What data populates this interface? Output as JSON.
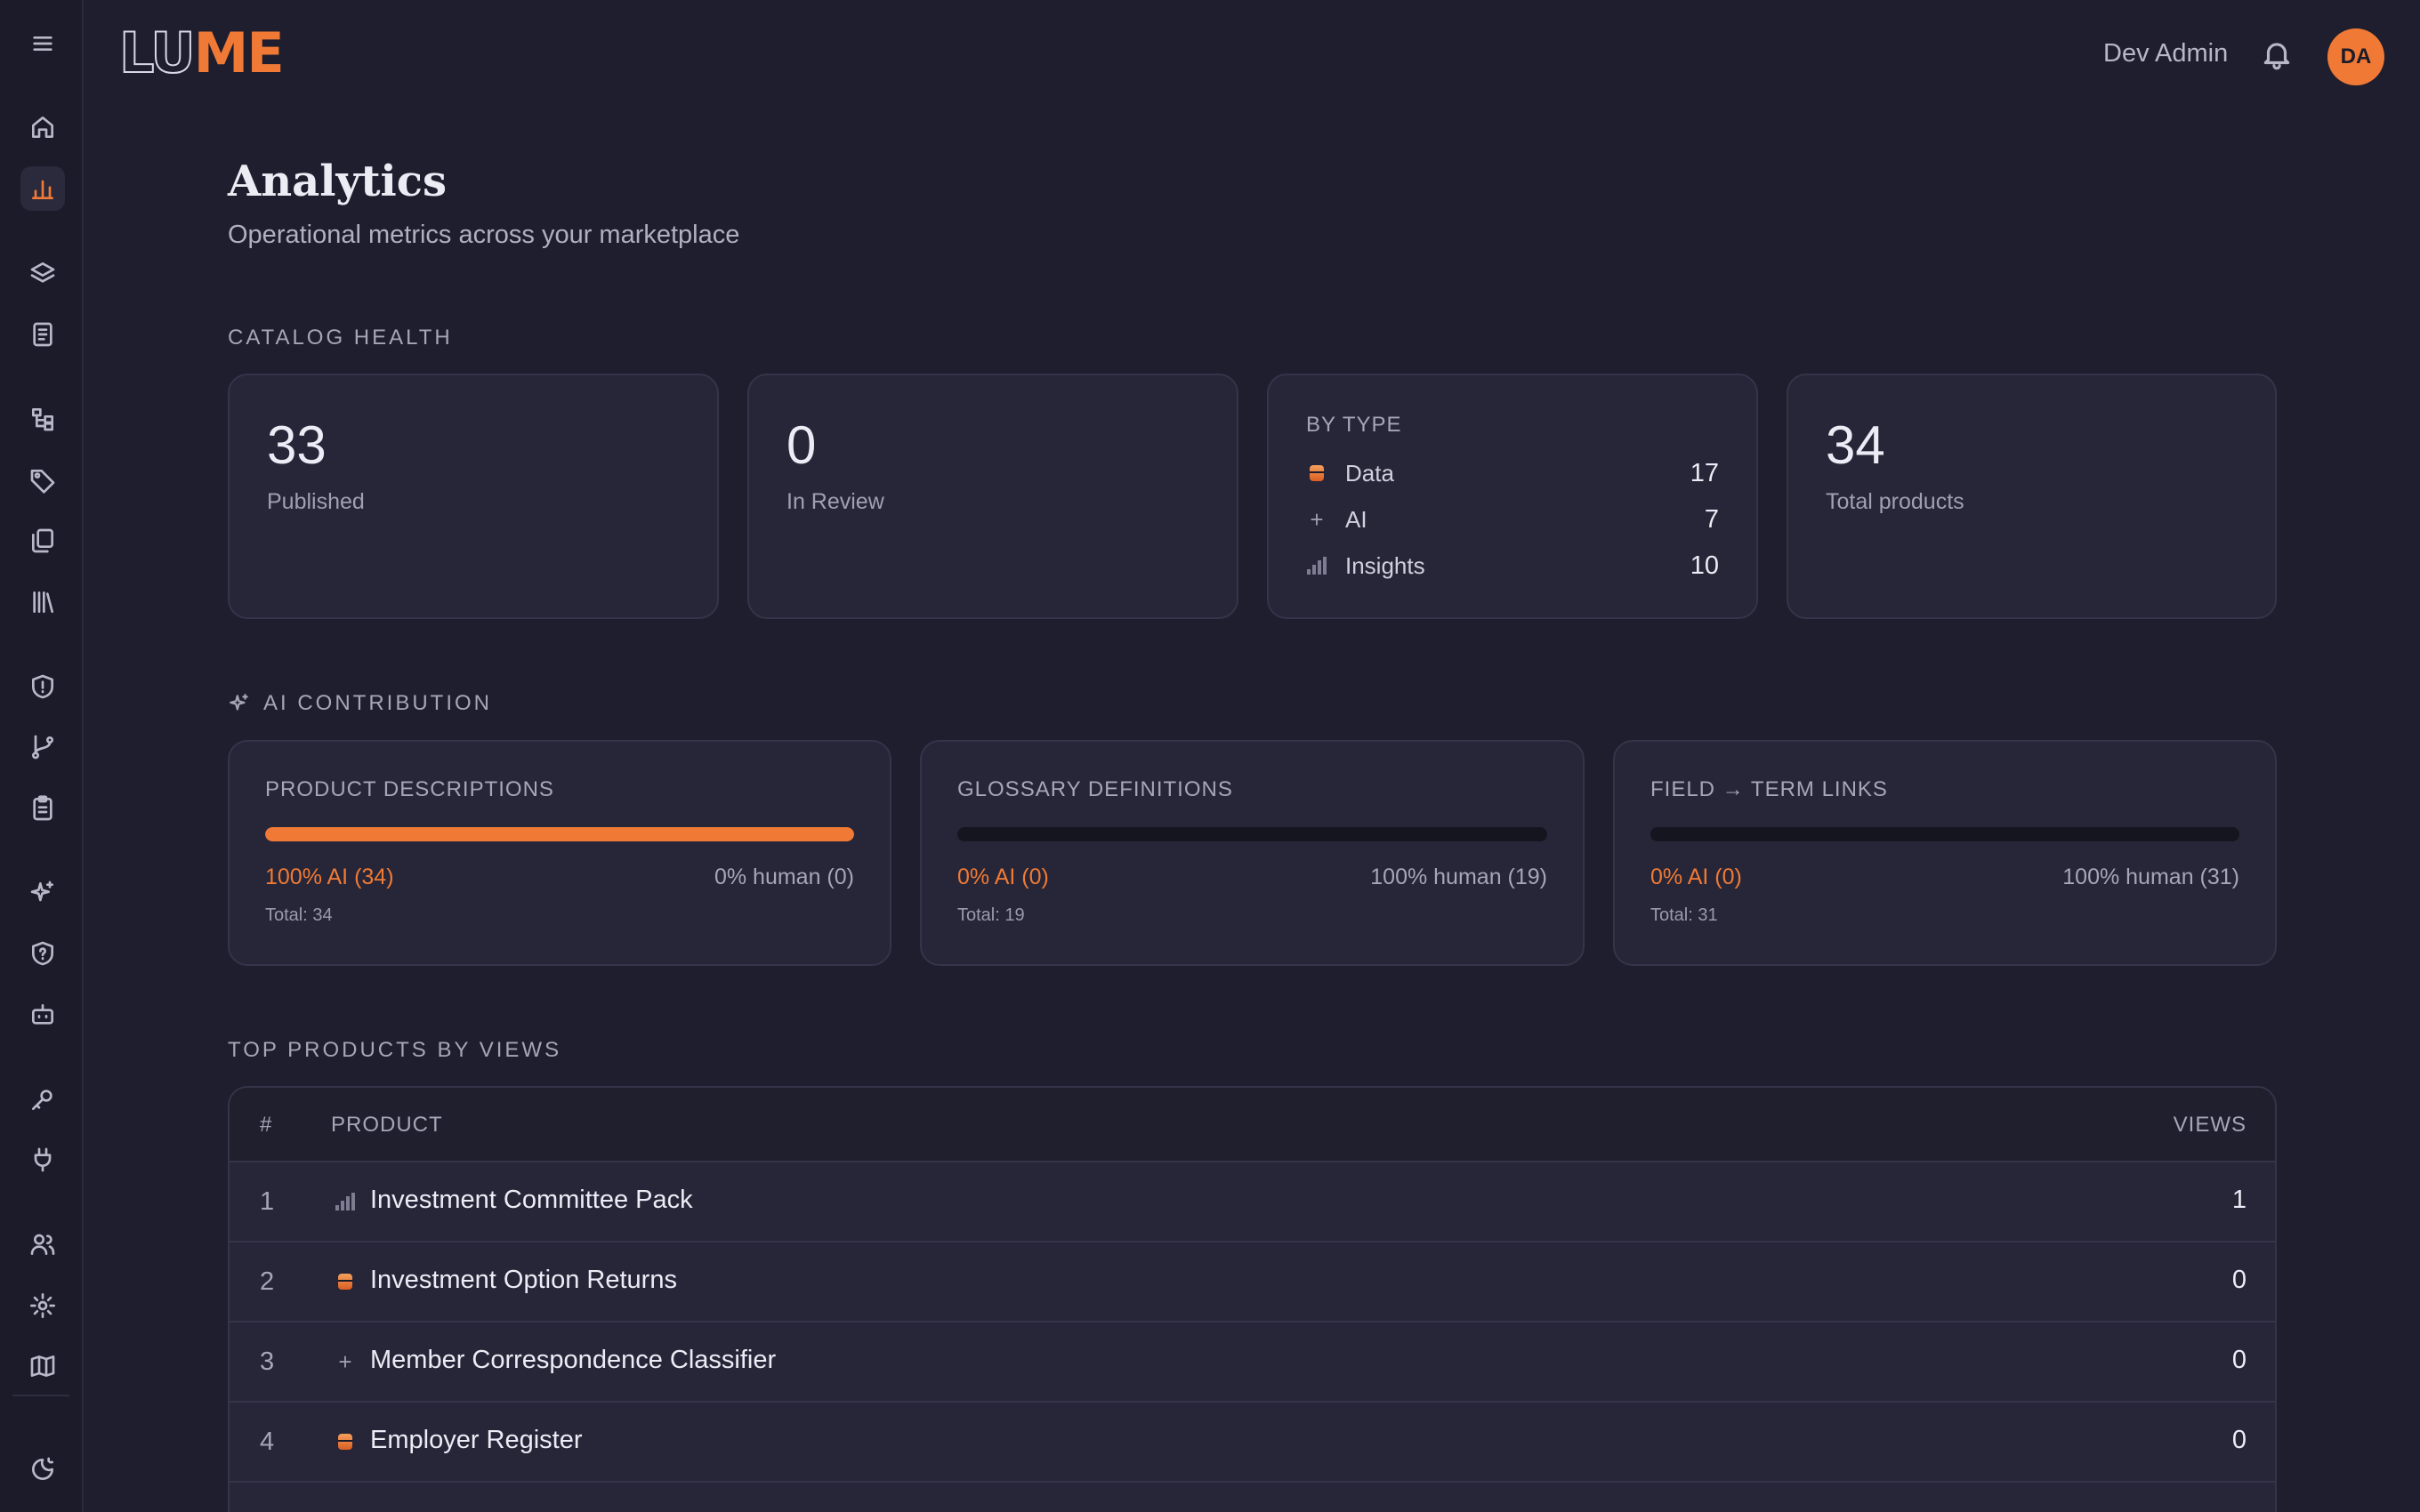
{
  "brand": {
    "logo_part1": "LU",
    "logo_part2": "ME"
  },
  "header": {
    "user_name": "Dev Admin",
    "avatar_initials": "DA"
  },
  "sidebar": {
    "items": [
      {
        "icon": "menu-icon"
      },
      {
        "icon": "home-icon"
      },
      {
        "icon": "analytics-icon",
        "active": true
      },
      {
        "icon": "layers-icon"
      },
      {
        "icon": "document-icon"
      },
      {
        "icon": "hierarchy-icon"
      },
      {
        "icon": "tag-icon"
      },
      {
        "icon": "copy-icon"
      },
      {
        "icon": "library-icon"
      },
      {
        "icon": "shield-alert-icon"
      },
      {
        "icon": "git-branch-icon"
      },
      {
        "icon": "clipboard-icon"
      },
      {
        "icon": "sparkles-icon"
      },
      {
        "icon": "shield-question-icon"
      },
      {
        "icon": "bot-icon"
      },
      {
        "icon": "key-icon"
      },
      {
        "icon": "plug-icon"
      },
      {
        "icon": "users-icon"
      },
      {
        "icon": "settings-icon"
      },
      {
        "icon": "map-icon"
      },
      {
        "icon": "theme-toggle-icon"
      }
    ]
  },
  "page": {
    "title": "Analytics",
    "subtitle": "Operational metrics across your marketplace"
  },
  "catalog_health": {
    "label": "CATALOG HEALTH",
    "published": {
      "value": "33",
      "label": "Published"
    },
    "in_review": {
      "value": "0",
      "label": "In Review"
    },
    "by_type": {
      "title": "BY TYPE",
      "rows": [
        {
          "icon": "data-icon",
          "label": "Data",
          "value": "17"
        },
        {
          "icon": "ai-icon",
          "label": "AI",
          "value": "7"
        },
        {
          "icon": "insights-icon",
          "label": "Insights",
          "value": "10"
        }
      ]
    },
    "total": {
      "value": "34",
      "label": "Total products"
    }
  },
  "ai_contribution": {
    "label": "AI CONTRIBUTION",
    "cards": [
      {
        "title": "PRODUCT DESCRIPTIONS",
        "ai_fraction": 1.0,
        "ai_text": "100% AI (34)",
        "human_text": "0% human (0)",
        "total_text": "Total: 34"
      },
      {
        "title": "GLOSSARY DEFINITIONS",
        "ai_fraction": 0.0,
        "ai_text": "0% AI (0)",
        "human_text": "100% human (19)",
        "total_text": "Total: 19"
      },
      {
        "title": "FIELD → TERM LINKS",
        "ai_fraction": 0.0,
        "ai_text": "0% AI (0)",
        "human_text": "100% human (31)",
        "total_text": "Total: 31"
      }
    ]
  },
  "top_products": {
    "label": "TOP PRODUCTS BY VIEWS",
    "columns": {
      "rank": "#",
      "product": "PRODUCT",
      "views": "VIEWS"
    },
    "rows": [
      {
        "rank": "1",
        "icon": "insights-icon",
        "name": "Investment Committee Pack",
        "views": "1"
      },
      {
        "rank": "2",
        "icon": "data-icon",
        "name": "Investment Option Returns",
        "views": "0"
      },
      {
        "rank": "3",
        "icon": "ai-icon",
        "name": "Member Correspondence Classifier",
        "views": "0"
      },
      {
        "rank": "4",
        "icon": "data-icon",
        "name": "Employer Register",
        "views": "0"
      }
    ]
  },
  "colors": {
    "accent": "#f07a35",
    "background": "#1e1e2e",
    "card": "#262638"
  }
}
